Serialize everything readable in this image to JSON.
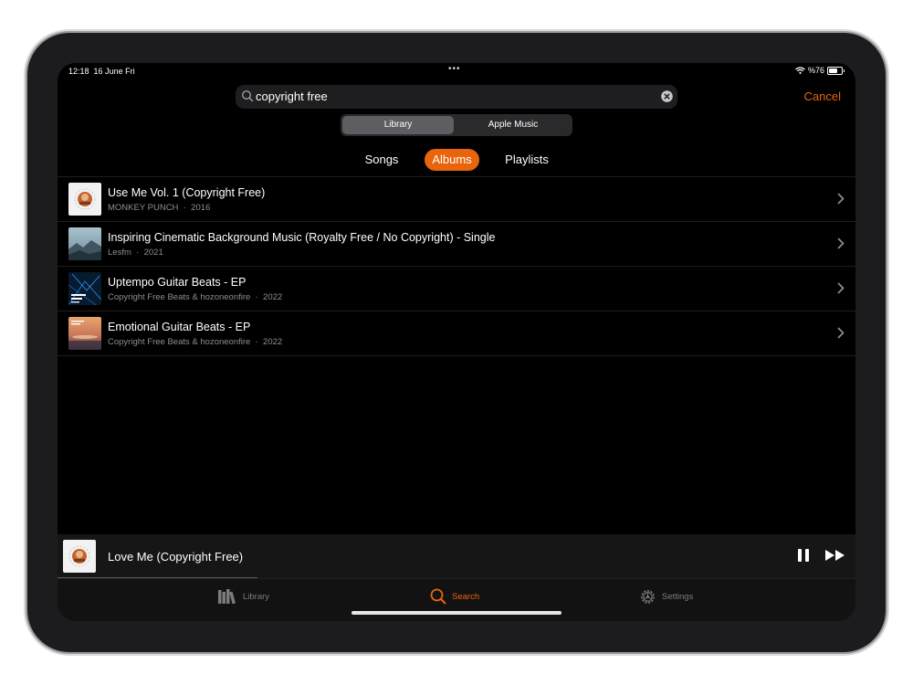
{
  "status_bar": {
    "time": "12:18",
    "date": "16 June Fri",
    "battery_text": "%76",
    "battery_level": 0.76
  },
  "search": {
    "query": "copyright free",
    "cancel_label": "Cancel"
  },
  "source_segments": [
    {
      "label": "Library",
      "active": true
    },
    {
      "label": "Apple Music",
      "active": false
    }
  ],
  "scope_tabs": [
    {
      "label": "Songs",
      "active": false
    },
    {
      "label": "Albums",
      "active": true
    },
    {
      "label": "Playlists",
      "active": false
    }
  ],
  "albums": [
    {
      "title": "Use Me Vol. 1 (Copyright Free)",
      "artist": "MONKEY PUNCH",
      "year": "2016"
    },
    {
      "title": "Inspiring Cinematic Background Music (Royalty Free / No Copyright) - Single",
      "artist": "Lesfm",
      "year": "2021"
    },
    {
      "title": "Uptempo Guitar Beats - EP",
      "artist": "Copyright Free Beats & hozoneonfire",
      "year": "2022"
    },
    {
      "title": "Emotional Guitar Beats - EP",
      "artist": "Copyright Free Beats & hozoneonfire",
      "year": "2022"
    }
  ],
  "separator": "·",
  "now_playing": {
    "title": "Love Me (Copyright Free)",
    "progress": 0.25
  },
  "tab_bar": [
    {
      "label": "Library",
      "icon": "library-icon",
      "active": false
    },
    {
      "label": "Search",
      "icon": "search-icon",
      "active": true
    },
    {
      "label": "Settings",
      "icon": "gear-icon",
      "active": false
    }
  ],
  "colors": {
    "accent": "#e8650d",
    "background": "#000000",
    "secondary_text": "#8e8e93"
  }
}
